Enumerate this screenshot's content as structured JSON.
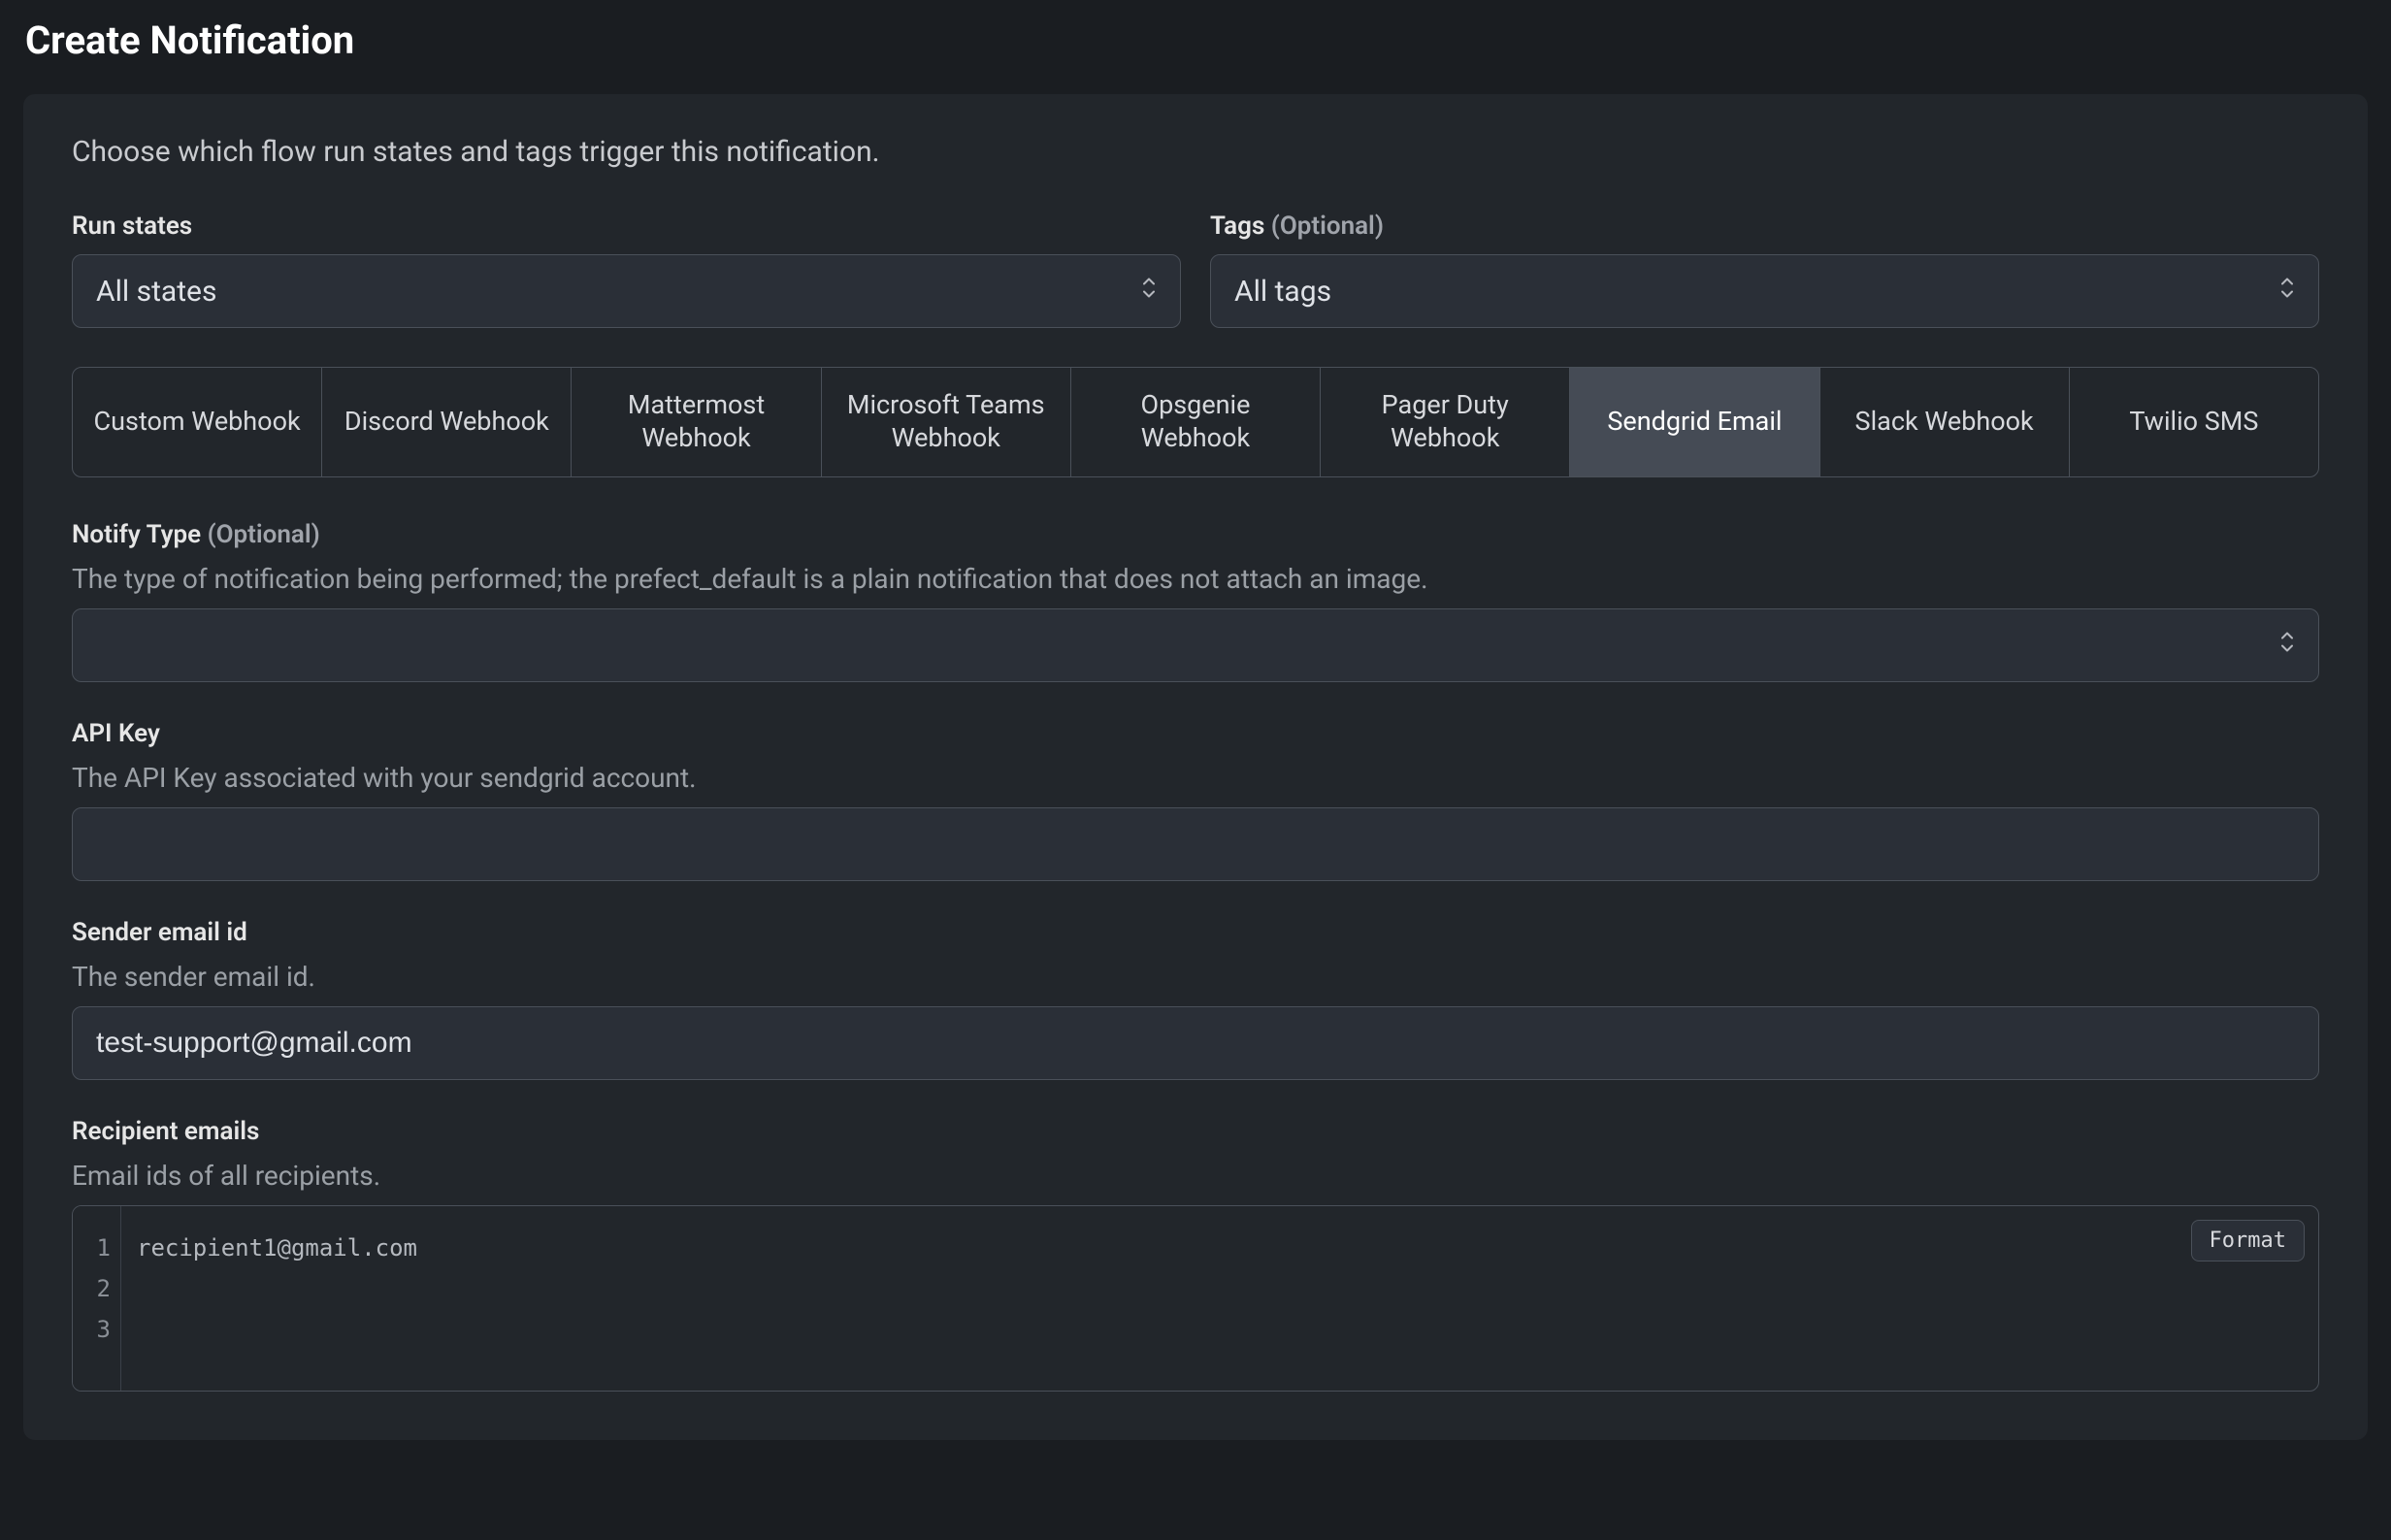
{
  "header": {
    "title": "Create Notification"
  },
  "intro": "Choose which flow run states and tags trigger this notification.",
  "runStates": {
    "label": "Run states",
    "value": "All states"
  },
  "tags": {
    "label": "Tags",
    "optional": "(Optional)",
    "value": "All tags"
  },
  "channels": [
    "Custom Webhook",
    "Discord Webhook",
    "Mattermost Webhook",
    "Microsoft Teams Webhook",
    "Opsgenie Webhook",
    "Pager Duty Webhook",
    "Sendgrid Email",
    "Slack Webhook",
    "Twilio SMS"
  ],
  "selectedChannel": "Sendgrid Email",
  "notifyType": {
    "label": "Notify Type",
    "optional": "(Optional)",
    "help": "The type of notification being performed; the prefect_default is a plain notification that does not attach an image.",
    "value": ""
  },
  "apiKey": {
    "label": "API Key",
    "help": "The API Key associated with your sendgrid account.",
    "value": ""
  },
  "senderEmail": {
    "label": "Sender email id",
    "help": "The sender email id.",
    "value": "test-support@gmail.com"
  },
  "recipientEmails": {
    "label": "Recipient emails",
    "help": "Email ids of all recipients.",
    "lines": [
      "recipient1@gmail.com",
      "",
      ""
    ],
    "formatLabel": "Format"
  }
}
